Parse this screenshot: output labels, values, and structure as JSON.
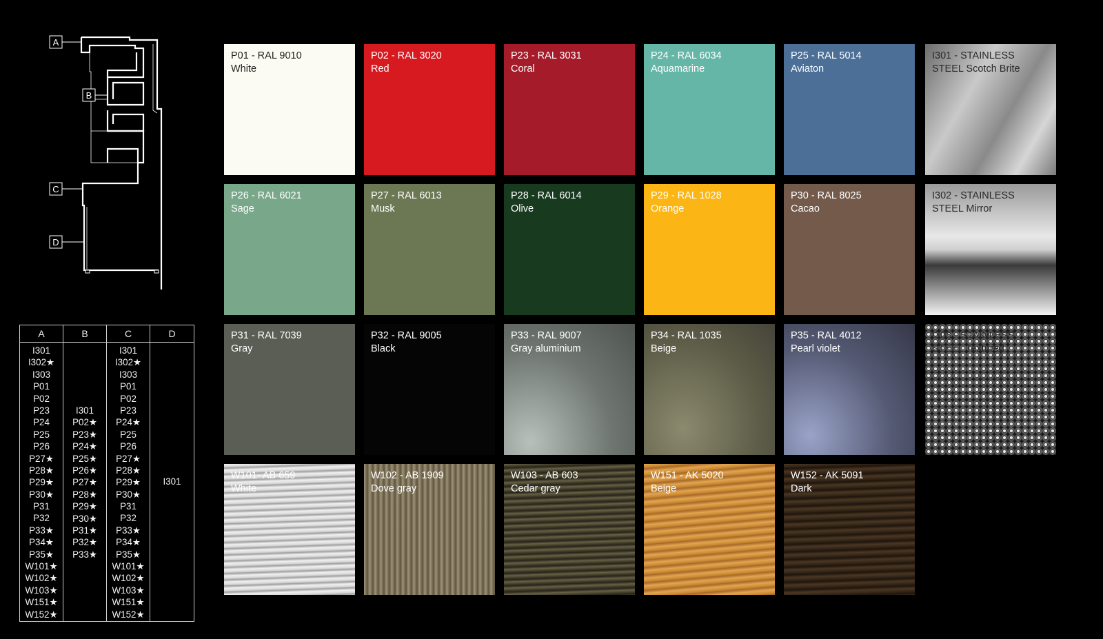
{
  "diagram": {
    "labels": [
      "A",
      "B",
      "C",
      "D"
    ]
  },
  "compat_table": {
    "headers": [
      "A",
      "B",
      "C",
      "D"
    ],
    "columns": [
      [
        "I301",
        "I302★",
        "I303",
        "P01",
        "P02",
        "P23",
        "P24",
        "P25",
        "P26",
        "P27★",
        "P28★",
        "P29★",
        "P30★",
        "P31",
        "P32",
        "P33★",
        "P34★",
        "P35★",
        "W101★",
        "W102★",
        "W103★",
        "W151★",
        "W152★"
      ],
      [
        "I301",
        "P02★",
        "P23★",
        "P24★",
        "P25★",
        "P26★",
        "P27★",
        "P28★",
        "P29★",
        "P30★",
        "P31★",
        "P32★",
        "P33★"
      ],
      [
        "I301",
        "I302★",
        "I303",
        "P01",
        "P02",
        "P23",
        "P24★",
        "P25",
        "P26",
        "P27★",
        "P28★",
        "P29★",
        "P30★",
        "P31",
        "P32",
        "P33★",
        "P34★",
        "P35★",
        "W101★",
        "W102★",
        "W103★",
        "W151★",
        "W152★"
      ],
      [
        "I301"
      ]
    ]
  },
  "swatches": [
    {
      "code": "P01 - RAL 9010",
      "name": "White",
      "color": "#fbfbf3"
    },
    {
      "code": "P02 - RAL 3020",
      "name": "Red",
      "color": "#d71920"
    },
    {
      "code": "P23 - RAL 3031",
      "name": "Coral",
      "color": "#a51b2a"
    },
    {
      "code": "P24 - RAL 6034",
      "name": "Aquamarine",
      "color": "#66b6a8"
    },
    {
      "code": "P25 - RAL 5014",
      "name": "Aviaton",
      "color": "#4b6f97"
    },
    {
      "code": "I301 - STAINLESS",
      "name": "STEEL Scotch Brite",
      "color": "#9a9a9a"
    },
    {
      "code": "P26 - RAL 6021",
      "name": "Sage",
      "color": "#78a889"
    },
    {
      "code": "P27 - RAL 6013",
      "name": "Musk",
      "color": "#6b7853"
    },
    {
      "code": "P28 - RAL 6014",
      "name": "Olive",
      "color": "#183a1f"
    },
    {
      "code": "P29 - RAL 1028",
      "name": "Orange",
      "color": "#fbb514"
    },
    {
      "code": "P30 - RAL 8025",
      "name": "Cacao",
      "color": "#735a4b"
    },
    {
      "code": "I302 - STAINLESS",
      "name": "STEEL Mirror",
      "color": "#b8b8b8"
    },
    {
      "code": "P31 - RAL 7039",
      "name": "Gray",
      "color": "#5a5e55"
    },
    {
      "code": "P32 - RAL 9005",
      "name": "Black",
      "color": "#050505"
    },
    {
      "code": "P33 - RAL 9007",
      "name": "Gray aluminium",
      "color": "#7c8380"
    },
    {
      "code": "P34 - RAL 1035",
      "name": "Beige",
      "color": "#6f6e56"
    },
    {
      "code": "P35 - RAL 4012",
      "name": "Pearl violet",
      "color": "#555a74"
    },
    {
      "code": "I303 - STAINLESS",
      "name": "STEEL Textured",
      "color": "#8a8a8a"
    },
    {
      "code": "W101- AB 659",
      "name": "White",
      "color": "#d8d8d8"
    },
    {
      "code": "W102 - AB 1909",
      "name": "Dove gray",
      "color": "#8a7e63"
    },
    {
      "code": "W103 - AB 603",
      "name": "Cedar gray",
      "color": "#4c4630"
    },
    {
      "code": "W151 - AK 5020",
      "name": "Beige",
      "color": "#d0913d"
    },
    {
      "code": "W152 - AK 5091",
      "name": "Dark",
      "color": "#3d2c1c"
    }
  ]
}
